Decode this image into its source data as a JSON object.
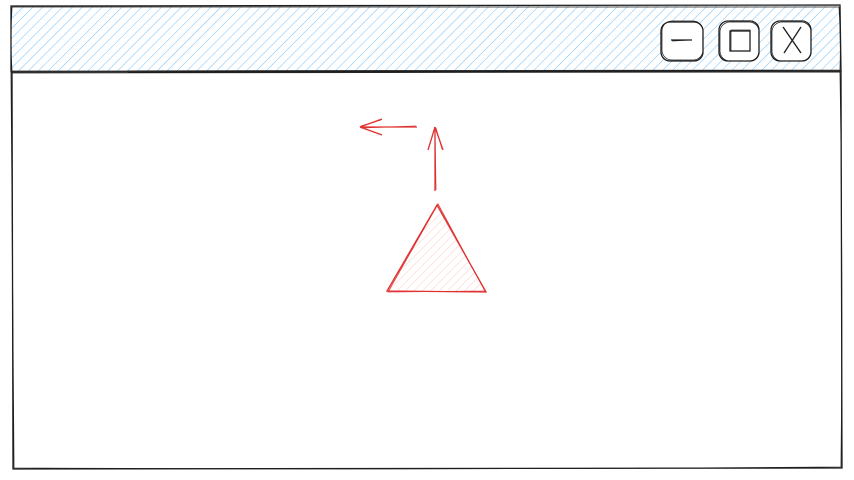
{
  "window": {
    "titlebar": {
      "fill_color": "#a5d8ff",
      "hatch_color": "#74c0fc",
      "buttons": [
        {
          "id": "minimize",
          "icon": "minimize-icon"
        },
        {
          "id": "maximize",
          "icon": "maximize-icon"
        },
        {
          "id": "close",
          "icon": "close-icon"
        }
      ]
    },
    "stroke_color": "#1e1e1e"
  },
  "sketch": {
    "shape": "triangle",
    "stroke_color": "#e03131",
    "fill_color": "#ffc9c9",
    "arrows": [
      {
        "id": "left-arrow",
        "direction": "left"
      },
      {
        "id": "up-arrow",
        "direction": "up"
      }
    ]
  }
}
